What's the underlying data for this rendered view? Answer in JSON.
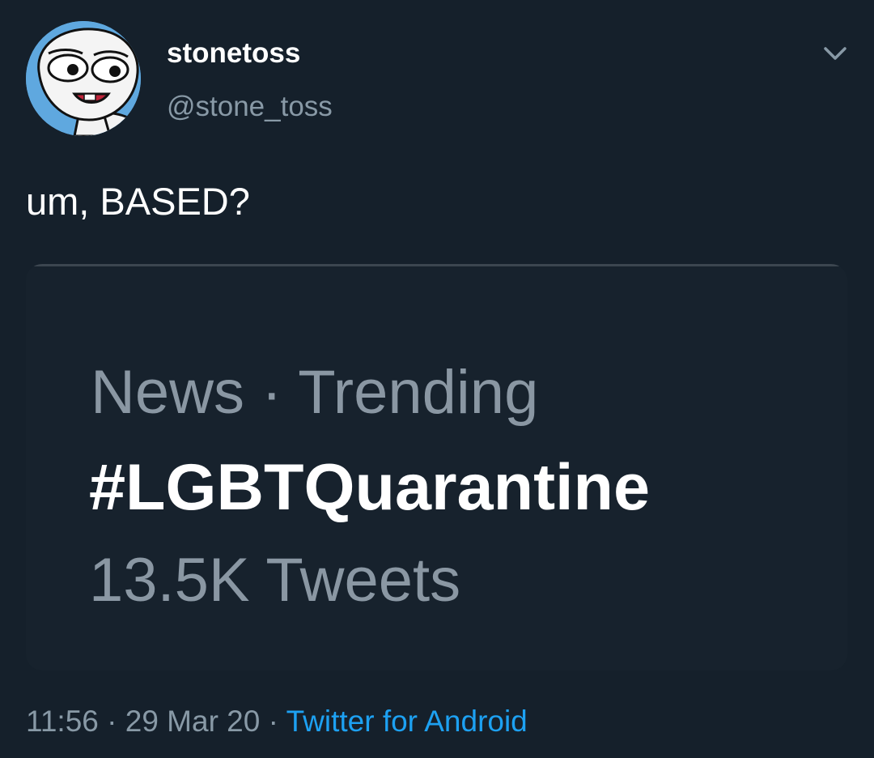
{
  "tweet": {
    "author": {
      "display_name": "stonetoss",
      "handle": "@stone_toss",
      "avatar_icon": "cartoon-face-avatar"
    },
    "more_options_icon": "chevron-down-icon",
    "text": "um, BASED?",
    "media": {
      "trend_category": "News · Trending",
      "trend_hashtag": "#LGBTQuarantine",
      "trend_count": "13.5K Tweets"
    },
    "time": "11:56",
    "date": "29 Mar 20",
    "separator": "·",
    "source": "Twitter for Android"
  },
  "colors": {
    "background": "#15202b",
    "primary_text": "#ffffff",
    "secondary_text": "#8899a6",
    "link": "#1da1f2",
    "avatar_bg": "#5fa8df"
  }
}
